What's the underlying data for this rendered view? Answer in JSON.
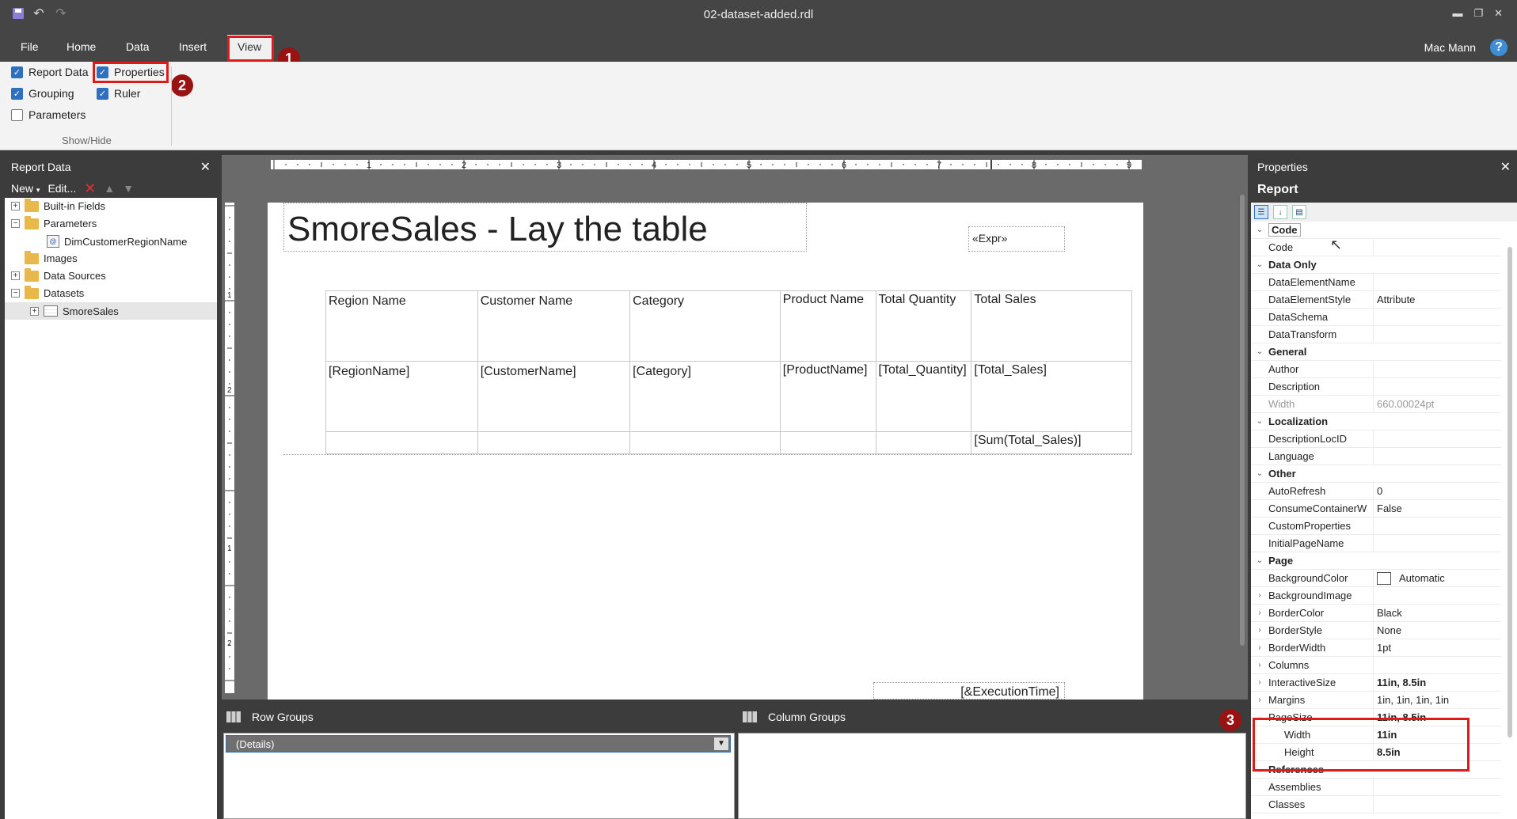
{
  "window": {
    "title": "02-dataset-added.rdl",
    "user": "Mac Mann",
    "help": "?"
  },
  "menu": [
    "File",
    "Home",
    "Data",
    "Insert",
    "View"
  ],
  "callouts": [
    "1",
    "2",
    "3"
  ],
  "ribbon": {
    "checkboxes": [
      {
        "label": "Report Data",
        "checked": true
      },
      {
        "label": "Grouping",
        "checked": true
      },
      {
        "label": "Parameters",
        "checked": false
      },
      {
        "label": "Properties",
        "checked": true
      },
      {
        "label": "Ruler",
        "checked": true
      }
    ],
    "group_label": "Show/Hide"
  },
  "report_data": {
    "title": "Report Data",
    "close": "✕",
    "toolbar": {
      "new": "New",
      "edit": "Edit..."
    },
    "tree": [
      {
        "label": "Built-in Fields"
      },
      {
        "label": "Parameters"
      },
      {
        "label": "DimCustomerRegionName"
      },
      {
        "label": "Images"
      },
      {
        "label": "Data Sources"
      },
      {
        "label": "Datasets"
      },
      {
        "label": "SmoreSales"
      }
    ]
  },
  "ruler": {
    "h_labels": [
      "1",
      "2",
      "3",
      "4",
      "5",
      "6",
      "7",
      "8",
      "9"
    ],
    "v_labels": [
      "1",
      "2",
      "1",
      "2"
    ]
  },
  "report": {
    "title": "SmoreSales - Lay the table",
    "expr": "«Expr»",
    "exec_time": "[&ExecutionTime]",
    "table": {
      "headers": [
        "Region Name",
        "Customer Name",
        "Category",
        "Product Name",
        "Total Quantity",
        "Total Sales"
      ],
      "detail": [
        "[RegionName]",
        "[CustomerName]",
        "[Category]",
        "[ProductName]",
        "[Total_Quantity]",
        "[Total_Sales]"
      ],
      "total": [
        "",
        "",
        "",
        "",
        "",
        "[Sum(Total_Sales)]"
      ]
    }
  },
  "groups": {
    "row_title": "Row Groups",
    "column_title": "Column Groups",
    "row_item": "(Details)"
  },
  "properties": {
    "title": "Properties",
    "close": "✕",
    "object": "Report",
    "rows": [
      {
        "type": "cat",
        "name": "Code"
      },
      {
        "type": "prop",
        "name": "Code",
        "value": ""
      },
      {
        "type": "cat",
        "name": "Data Only"
      },
      {
        "type": "prop",
        "name": "DataElementName",
        "value": ""
      },
      {
        "type": "prop",
        "name": "DataElementStyle",
        "value": "Attribute"
      },
      {
        "type": "prop",
        "name": "DataSchema",
        "value": ""
      },
      {
        "type": "prop",
        "name": "DataTransform",
        "value": ""
      },
      {
        "type": "cat",
        "name": "General"
      },
      {
        "type": "prop",
        "name": "Author",
        "value": ""
      },
      {
        "type": "prop",
        "name": "Description",
        "value": ""
      },
      {
        "type": "prop",
        "name": "Width",
        "value": "660.00024pt",
        "gray": true
      },
      {
        "type": "cat",
        "name": "Localization"
      },
      {
        "type": "prop",
        "name": "DescriptionLocID",
        "value": ""
      },
      {
        "type": "prop",
        "name": "Language",
        "value": ""
      },
      {
        "type": "cat",
        "name": "Other"
      },
      {
        "type": "prop",
        "name": "AutoRefresh",
        "value": "0"
      },
      {
        "type": "prop",
        "name": "ConsumeContainerW",
        "value": "False"
      },
      {
        "type": "prop",
        "name": "CustomProperties",
        "value": ""
      },
      {
        "type": "prop",
        "name": "InitialPageName",
        "value": ""
      },
      {
        "type": "cat",
        "name": "Page"
      },
      {
        "type": "prop",
        "name": "BackgroundColor",
        "value": "Automatic",
        "swatch": true
      },
      {
        "type": "prop",
        "name": "BackgroundImage",
        "value": "",
        "expander": ">"
      },
      {
        "type": "prop",
        "name": "BorderColor",
        "value": "Black",
        "expander": ">"
      },
      {
        "type": "prop",
        "name": "BorderStyle",
        "value": "None",
        "expander": ">"
      },
      {
        "type": "prop",
        "name": "BorderWidth",
        "value": "1pt",
        "expander": ">"
      },
      {
        "type": "prop",
        "name": "Columns",
        "value": "",
        "expander": ">"
      },
      {
        "type": "prop",
        "name": "InteractiveSize",
        "value": "11in, 8.5in",
        "bold": true,
        "expander": ">"
      },
      {
        "type": "prop",
        "name": "Margins",
        "value": "1in, 1in, 1in, 1in",
        "expander": ">"
      },
      {
        "type": "prop",
        "name": "PageSize",
        "value": "11in, 8.5in",
        "bold": true,
        "expander": "v"
      },
      {
        "type": "sub",
        "name": "Width",
        "value": "11in",
        "bold": true
      },
      {
        "type": "sub",
        "name": "Height",
        "value": "8.5in",
        "bold": true
      },
      {
        "type": "cat",
        "name": "References"
      },
      {
        "type": "prop",
        "name": "Assemblies",
        "value": ""
      },
      {
        "type": "prop",
        "name": "Classes",
        "value": ""
      }
    ]
  }
}
